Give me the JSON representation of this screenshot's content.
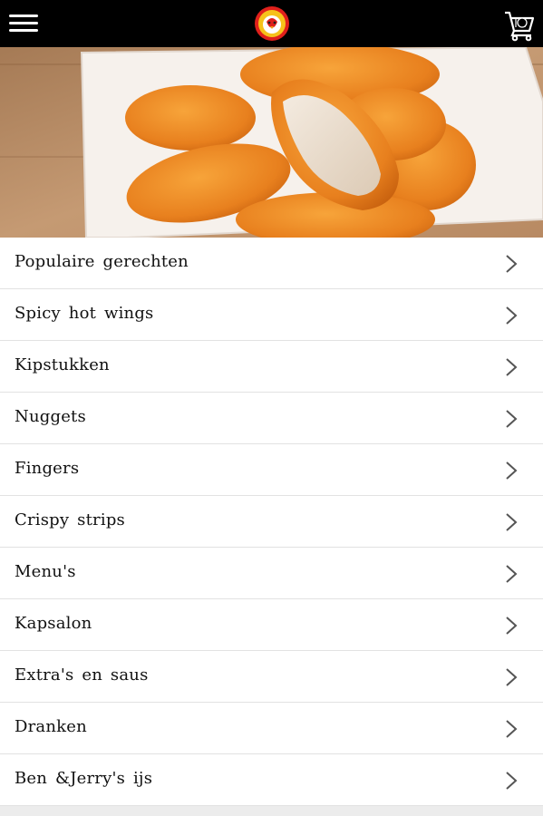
{
  "header": {
    "menu_icon": "hamburger-menu-icon",
    "logo_icon": "chicken-logo",
    "cart_icon": "shopping-cart-icon"
  },
  "hero": {
    "image": "chicken-nuggets-photo"
  },
  "categories": [
    {
      "label": "Populaire gerechten"
    },
    {
      "label": "Spicy hot wings"
    },
    {
      "label": "Kipstukken"
    },
    {
      "label": "Nuggets"
    },
    {
      "label": "Fingers"
    },
    {
      "label": "Crispy strips"
    },
    {
      "label": "Menu's"
    },
    {
      "label": "Kapsalon"
    },
    {
      "label": "Extra's en saus"
    },
    {
      "label": "Dranken"
    },
    {
      "label": "Ben &Jerry's ijs"
    }
  ],
  "colors": {
    "topbar": "#000000",
    "list_background": "#ffffff",
    "divider": "#e2e2e2",
    "text": "#111111",
    "chevron": "#555555"
  }
}
